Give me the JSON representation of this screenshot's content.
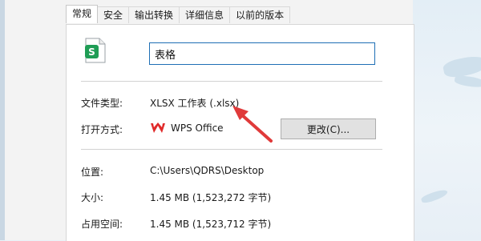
{
  "tabs": [
    {
      "label": "常规",
      "active": true
    },
    {
      "label": "安全",
      "active": false
    },
    {
      "label": "输出转换",
      "active": false
    },
    {
      "label": "详细信息",
      "active": false
    },
    {
      "label": "以前的版本",
      "active": false
    }
  ],
  "general": {
    "file_icon_letter": "S",
    "file_name_value": "表格",
    "file_type_label": "文件类型:",
    "file_type_value": "XLSX 工作表 (.xlsx)",
    "open_with_label": "打开方式:",
    "open_with_app": "WPS Office",
    "change_button_label": "更改(C)...",
    "location_label": "位置:",
    "location_value": "C:\\Users\\QDRS\\Desktop",
    "size_label": "大小:",
    "size_value": "1.45 MB (1,523,272 字节)",
    "size_on_disk_label": "占用空间:",
    "size_on_disk_value": "1.45 MB (1,523,712 字节)"
  },
  "colors": {
    "accent_input_border": "#1f6fb5",
    "spreadsheet_icon": "#1f9d55",
    "wps_red": "#e02a2a",
    "annotation_arrow": "#e03a3a"
  },
  "icons": [
    "spreadsheet-file-icon",
    "wps-office-icon",
    "annotation-arrow"
  ]
}
